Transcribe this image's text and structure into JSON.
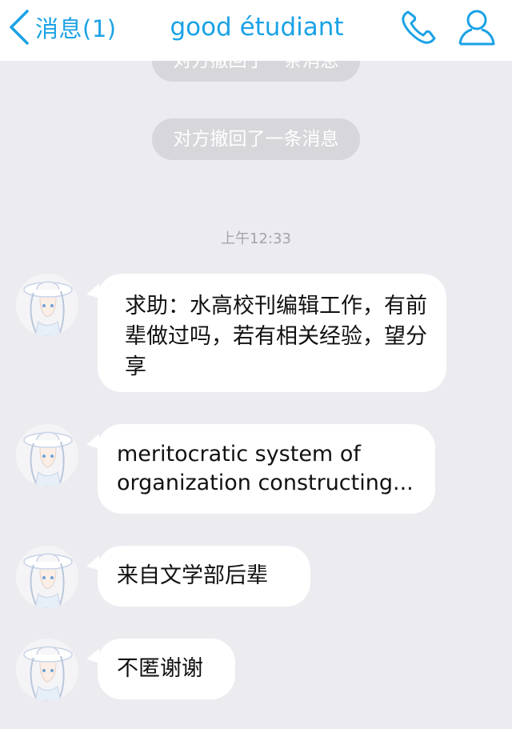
{
  "header": {
    "back_label": "消息(1)",
    "title": "good étudiant",
    "back_icon": "chevron-left-icon",
    "call_icon": "phone-icon",
    "profile_icon": "person-icon",
    "accent_color": "#1aa2e6"
  },
  "notices": {
    "partial": "对方撤回了一条消息",
    "full": "对方撤回了一条消息"
  },
  "timestamp": "上午12:33",
  "messages": [
    {
      "text": "求助：水高校刊编辑工作，有前辈做过吗，若有相关经验，望分享"
    },
    {
      "text": "meritocratic system of organization constructing..."
    },
    {
      "text": "来自文学部后辈"
    },
    {
      "text": "不匿谢谢"
    }
  ]
}
